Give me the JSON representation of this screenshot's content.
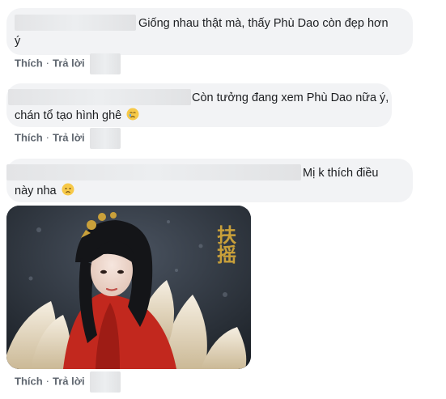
{
  "comments": [
    {
      "text_line1": "Giống nhau thật mà, thấy Phù Dao còn đẹp hơn",
      "text_line2": "ý",
      "like_label": "Thích",
      "reply_label": "Trả lời",
      "separator": "·"
    },
    {
      "text_line1": "Còn tưởng đang xem Phù Dao nữa ý,",
      "text_line2": "chán tổ tạo hình ghê",
      "emoji_icon": "crying-face",
      "like_label": "Thích",
      "reply_label": "Trả lời",
      "separator": "·"
    },
    {
      "text_line1": "Mị k thích điều",
      "text_line2": "này nha",
      "emoji_icon": "disappointed-face",
      "like_label": "Thích",
      "reply_label": "Trả lời",
      "separator": "·",
      "image_watermark": "扶摇"
    }
  ],
  "colors": {
    "bubble": "#f2f3f5",
    "action_text": "#606770",
    "text": "#1c1e21",
    "watermark": "#c9a03a"
  }
}
